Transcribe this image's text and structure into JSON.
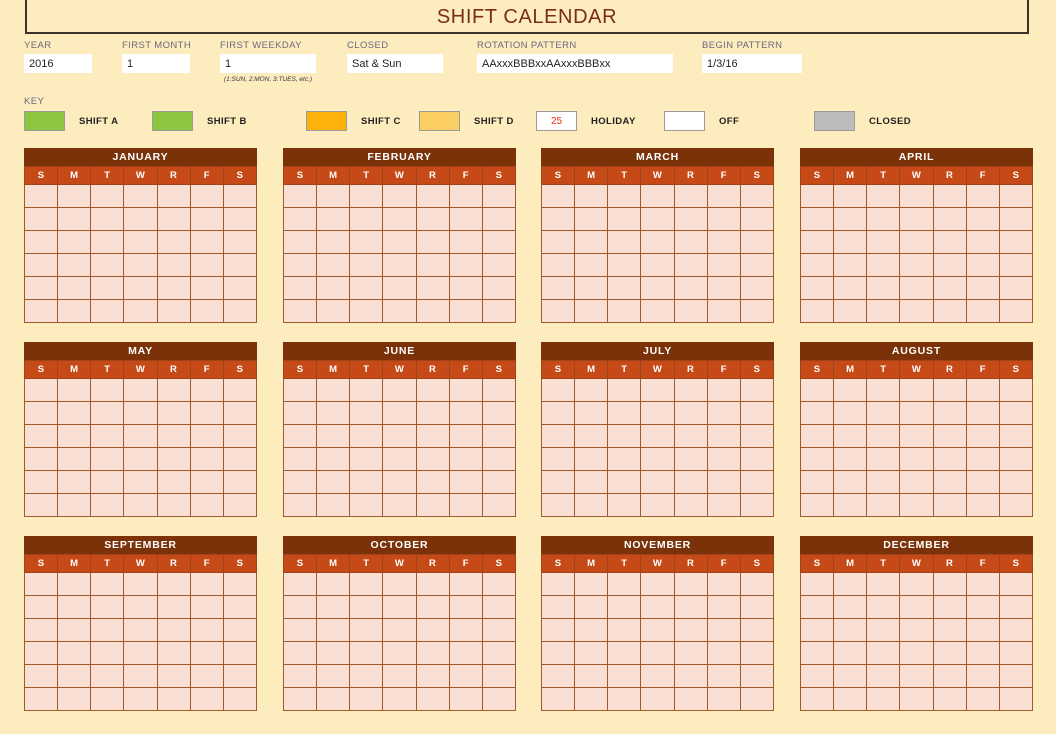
{
  "page": {
    "title": "SHIFT CALENDAR",
    "background_color": "#FCECBE"
  },
  "settings": {
    "fields": [
      {
        "label": "YEAR",
        "value": "2016",
        "hint": ""
      },
      {
        "label": "FIRST MONTH",
        "value": "1",
        "hint": ""
      },
      {
        "label": "FIRST WEEKDAY",
        "value": "1",
        "hint": "(1:SUN, 2:MON, 3:TUES, etc.)"
      },
      {
        "label": "CLOSED",
        "value": "Sat & Sun",
        "hint": ""
      },
      {
        "label": "ROTATION PATTERN",
        "value": "AAxxxBBBxxAAxxxBBBxx",
        "hint": ""
      },
      {
        "label": "BEGIN PATTERN",
        "value": "1/3/16",
        "hint": ""
      }
    ]
  },
  "key": {
    "label": "KEY",
    "items": [
      {
        "name": "SHIFT A",
        "color": "#8DC63F",
        "swatch_text": ""
      },
      {
        "name": "SHIFT B",
        "color": "#8DC63F",
        "swatch_text": ""
      },
      {
        "name": "SHIFT C",
        "color": "#FDB10B",
        "swatch_text": ""
      },
      {
        "name": "SHIFT D",
        "color": "#FBCE64",
        "swatch_text": ""
      },
      {
        "name": "HOLIDAY",
        "color": "#FFFFFF",
        "swatch_text": "25"
      },
      {
        "name": "OFF",
        "color": "#FFFFFF",
        "swatch_text": ""
      },
      {
        "name": "CLOSED",
        "color": "#BCBCBC",
        "swatch_text": ""
      }
    ]
  },
  "calendar": {
    "weekday_headers": [
      "S",
      "M",
      "T",
      "W",
      "R",
      "F",
      "S"
    ],
    "weeks_per_month": 6,
    "months": [
      "JANUARY",
      "FEBRUARY",
      "MARCH",
      "APRIL",
      "MAY",
      "JUNE",
      "JULY",
      "AUGUST",
      "SEPTEMBER",
      "OCTOBER",
      "NOVEMBER",
      "DECEMBER"
    ],
    "month_header_color": "#7B3209",
    "weekday_header_color": "#C64A17",
    "cell_color": "#FAE0D4",
    "cell_border_color": "#A05A2C",
    "cells": [
      [
        [
          "",
          "",
          "",
          "",
          "",
          ""
        ],
        [
          "",
          "",
          "",
          "",
          "",
          ""
        ],
        [
          "",
          "",
          "",
          "",
          "",
          ""
        ],
        [
          "",
          "",
          "",
          "",
          "",
          ""
        ],
        [
          "",
          "",
          "",
          "",
          "",
          ""
        ],
        [
          "",
          "",
          "",
          "",
          "",
          ""
        ],
        [
          "",
          "",
          "",
          "",
          "",
          ""
        ]
      ]
    ]
  }
}
